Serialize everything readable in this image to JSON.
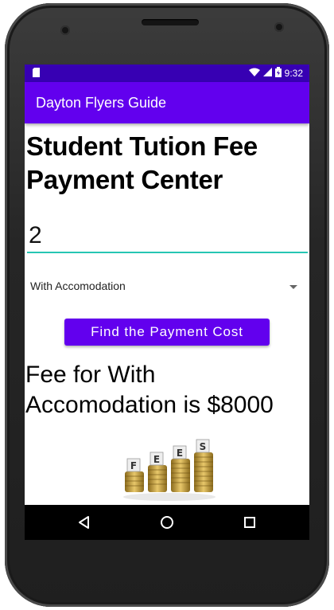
{
  "status_bar": {
    "time": "9:32",
    "left_icon": "sd-card-icon",
    "right_icons": [
      "wifi-icon",
      "signal-icon",
      "battery-charging-icon"
    ]
  },
  "app_bar": {
    "title": "Dayton Flyers Guide"
  },
  "main": {
    "heading": "Student Tution Fee Payment Center",
    "quantity_value": "2",
    "accommodation_selected": "With Accomodation",
    "find_button_label": "Find the Payment Cost",
    "result_text": "Fee for With Accomodation is $8000",
    "fees_image_letters": [
      "F",
      "E",
      "E",
      "S"
    ]
  },
  "nav_bar": {
    "back_icon": "back-triangle-icon",
    "home_icon": "home-circle-icon",
    "recents_icon": "recents-square-icon"
  },
  "colors": {
    "status_bar": "#3700b3",
    "primary": "#6200ee",
    "input_underline": "#26c6b3"
  }
}
